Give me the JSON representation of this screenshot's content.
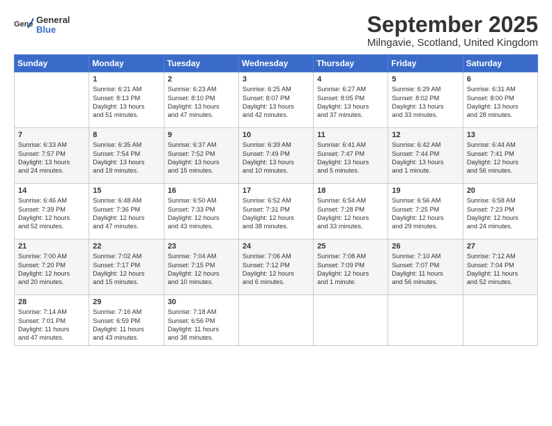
{
  "header": {
    "title": "September 2025",
    "location": "Milngavie, Scotland, United Kingdom"
  },
  "columns": [
    "Sunday",
    "Monday",
    "Tuesday",
    "Wednesday",
    "Thursday",
    "Friday",
    "Saturday"
  ],
  "weeks": [
    [
      {
        "day": "",
        "text": ""
      },
      {
        "day": "1",
        "text": "Sunrise: 6:21 AM\nSunset: 8:13 PM\nDaylight: 13 hours\nand 51 minutes."
      },
      {
        "day": "2",
        "text": "Sunrise: 6:23 AM\nSunset: 8:10 PM\nDaylight: 13 hours\nand 47 minutes."
      },
      {
        "day": "3",
        "text": "Sunrise: 6:25 AM\nSunset: 8:07 PM\nDaylight: 13 hours\nand 42 minutes."
      },
      {
        "day": "4",
        "text": "Sunrise: 6:27 AM\nSunset: 8:05 PM\nDaylight: 13 hours\nand 37 minutes."
      },
      {
        "day": "5",
        "text": "Sunrise: 6:29 AM\nSunset: 8:02 PM\nDaylight: 13 hours\nand 33 minutes."
      },
      {
        "day": "6",
        "text": "Sunrise: 6:31 AM\nSunset: 8:00 PM\nDaylight: 13 hours\nand 28 minutes."
      }
    ],
    [
      {
        "day": "7",
        "text": "Sunrise: 6:33 AM\nSunset: 7:57 PM\nDaylight: 13 hours\nand 24 minutes."
      },
      {
        "day": "8",
        "text": "Sunrise: 6:35 AM\nSunset: 7:54 PM\nDaylight: 13 hours\nand 19 minutes."
      },
      {
        "day": "9",
        "text": "Sunrise: 6:37 AM\nSunset: 7:52 PM\nDaylight: 13 hours\nand 15 minutes."
      },
      {
        "day": "10",
        "text": "Sunrise: 6:39 AM\nSunset: 7:49 PM\nDaylight: 13 hours\nand 10 minutes."
      },
      {
        "day": "11",
        "text": "Sunrise: 6:41 AM\nSunset: 7:47 PM\nDaylight: 13 hours\nand 5 minutes."
      },
      {
        "day": "12",
        "text": "Sunrise: 6:42 AM\nSunset: 7:44 PM\nDaylight: 13 hours\nand 1 minute."
      },
      {
        "day": "13",
        "text": "Sunrise: 6:44 AM\nSunset: 7:41 PM\nDaylight: 12 hours\nand 56 minutes."
      }
    ],
    [
      {
        "day": "14",
        "text": "Sunrise: 6:46 AM\nSunset: 7:39 PM\nDaylight: 12 hours\nand 52 minutes."
      },
      {
        "day": "15",
        "text": "Sunrise: 6:48 AM\nSunset: 7:36 PM\nDaylight: 12 hours\nand 47 minutes."
      },
      {
        "day": "16",
        "text": "Sunrise: 6:50 AM\nSunset: 7:33 PM\nDaylight: 12 hours\nand 43 minutes."
      },
      {
        "day": "17",
        "text": "Sunrise: 6:52 AM\nSunset: 7:31 PM\nDaylight: 12 hours\nand 38 minutes."
      },
      {
        "day": "18",
        "text": "Sunrise: 6:54 AM\nSunset: 7:28 PM\nDaylight: 12 hours\nand 33 minutes."
      },
      {
        "day": "19",
        "text": "Sunrise: 6:56 AM\nSunset: 7:25 PM\nDaylight: 12 hours\nand 29 minutes."
      },
      {
        "day": "20",
        "text": "Sunrise: 6:58 AM\nSunset: 7:23 PM\nDaylight: 12 hours\nand 24 minutes."
      }
    ],
    [
      {
        "day": "21",
        "text": "Sunrise: 7:00 AM\nSunset: 7:20 PM\nDaylight: 12 hours\nand 20 minutes."
      },
      {
        "day": "22",
        "text": "Sunrise: 7:02 AM\nSunset: 7:17 PM\nDaylight: 12 hours\nand 15 minutes."
      },
      {
        "day": "23",
        "text": "Sunrise: 7:04 AM\nSunset: 7:15 PM\nDaylight: 12 hours\nand 10 minutes."
      },
      {
        "day": "24",
        "text": "Sunrise: 7:06 AM\nSunset: 7:12 PM\nDaylight: 12 hours\nand 6 minutes."
      },
      {
        "day": "25",
        "text": "Sunrise: 7:08 AM\nSunset: 7:09 PM\nDaylight: 12 hours\nand 1 minute."
      },
      {
        "day": "26",
        "text": "Sunrise: 7:10 AM\nSunset: 7:07 PM\nDaylight: 11 hours\nand 56 minutes."
      },
      {
        "day": "27",
        "text": "Sunrise: 7:12 AM\nSunset: 7:04 PM\nDaylight: 11 hours\nand 52 minutes."
      }
    ],
    [
      {
        "day": "28",
        "text": "Sunrise: 7:14 AM\nSunset: 7:01 PM\nDaylight: 11 hours\nand 47 minutes."
      },
      {
        "day": "29",
        "text": "Sunrise: 7:16 AM\nSunset: 6:59 PM\nDaylight: 11 hours\nand 43 minutes."
      },
      {
        "day": "30",
        "text": "Sunrise: 7:18 AM\nSunset: 6:56 PM\nDaylight: 11 hours\nand 38 minutes."
      },
      {
        "day": "",
        "text": ""
      },
      {
        "day": "",
        "text": ""
      },
      {
        "day": "",
        "text": ""
      },
      {
        "day": "",
        "text": ""
      }
    ]
  ]
}
